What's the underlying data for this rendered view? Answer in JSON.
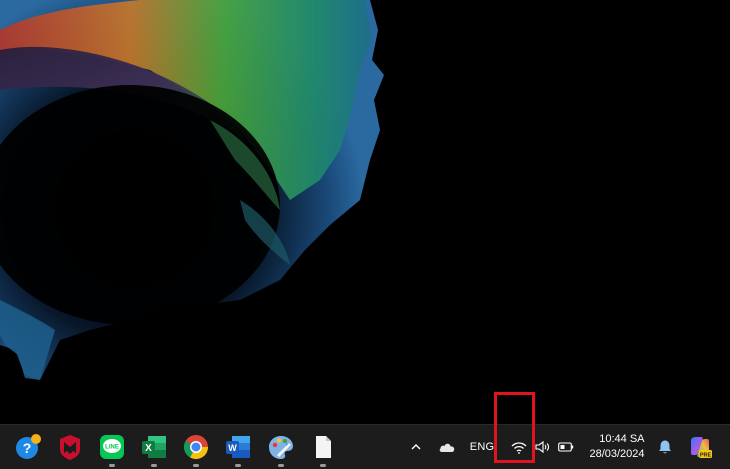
{
  "wallpaper": {
    "description_name": "abstract-colorful-burst-wallpaper"
  },
  "taskbar": {
    "apps": [
      {
        "name": "help-app",
        "icon": "help-question-icon",
        "running": false
      },
      {
        "name": "mcafee-app",
        "icon": "mcafee-shield-icon",
        "running": false
      },
      {
        "name": "line-app",
        "icon": "line-chat-icon",
        "label": "LINE",
        "running": true
      },
      {
        "name": "excel-app",
        "icon": "excel-icon",
        "label": "X",
        "running": true
      },
      {
        "name": "chrome-app",
        "icon": "chrome-icon",
        "running": true
      },
      {
        "name": "word-app",
        "icon": "word-icon",
        "label": "W",
        "running": true
      },
      {
        "name": "paint-app",
        "icon": "paint-palette-icon",
        "running": true
      },
      {
        "name": "notepad-app",
        "icon": "file-icon",
        "running": true
      }
    ],
    "tray": {
      "show_hidden_icon": "chevron-up-icon",
      "onedrive_icon": "cloud-icon",
      "language": "ENG",
      "wifi_icon": "wifi-icon",
      "volume_icon": "speaker-icon",
      "battery_icon": "battery-icon",
      "time": "10:44 SA",
      "date": "28/03/2024",
      "notification_icon": "bell-icon",
      "copilot_icon": "copilot-icon",
      "copilot_badge": "PRE"
    },
    "highlight_color": "#e0141e"
  }
}
